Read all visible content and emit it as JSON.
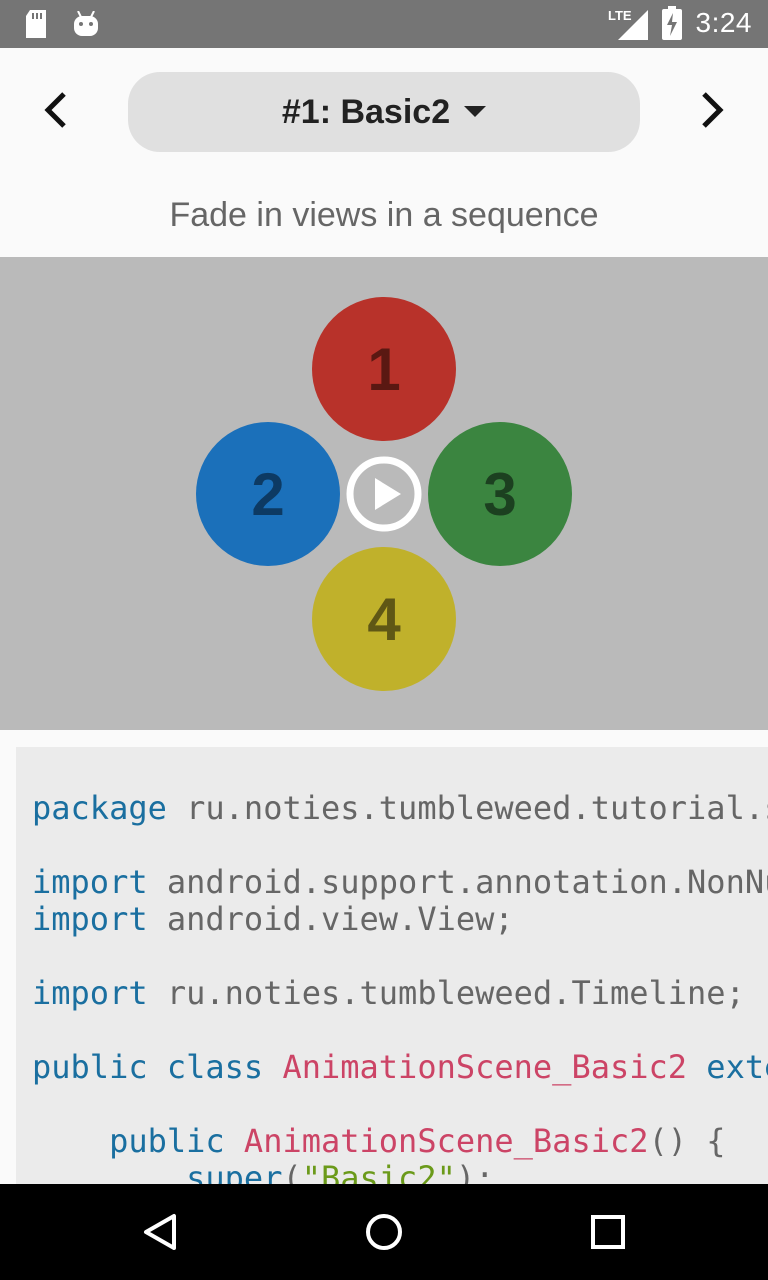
{
  "status_bar": {
    "time": "3:24",
    "network": "LTE",
    "icons": [
      "sd-card-icon",
      "android-icon",
      "lte-signal-icon",
      "battery-charging-icon"
    ]
  },
  "toolbar": {
    "title": "#1: Basic2",
    "prev_icon": "chevron-left-icon",
    "next_icon": "chevron-right-icon",
    "dropdown_icon": "caret-down-icon"
  },
  "subtitle": "Fade in views in a sequence",
  "scene": {
    "background": "#bababa",
    "circles": [
      {
        "label": "1",
        "color": "#b8322a",
        "text_color": "#5a1812"
      },
      {
        "label": "2",
        "color": "#1b70ba",
        "text_color": "#0d3a63"
      },
      {
        "label": "3",
        "color": "#3b8540",
        "text_color": "#1c4020"
      },
      {
        "label": "4",
        "color": "#c0b12b",
        "text_color": "#5f5715"
      }
    ],
    "play_icon": "play-circle-icon"
  },
  "code": {
    "lines": [
      [
        {
          "t": "package",
          "c": "kw"
        },
        {
          "t": " ru.noties.tumbleweed.tutorial.s",
          "c": ""
        }
      ],
      [
        {
          "t": "import",
          "c": "kw"
        },
        {
          "t": " android.support.annotation.NonNu",
          "c": ""
        }
      ],
      [
        {
          "t": "import",
          "c": "kw"
        },
        {
          "t": " android.view.View;",
          "c": ""
        }
      ],
      [
        {
          "t": "import",
          "c": "kw"
        },
        {
          "t": " ru.noties.tumbleweed.Timeline;",
          "c": ""
        }
      ],
      [
        {
          "t": "public class",
          "c": "kw"
        },
        {
          "t": " ",
          "c": ""
        },
        {
          "t": "AnimationScene_Basic2",
          "c": "cls"
        },
        {
          "t": " exte",
          "c": "kw"
        }
      ],
      [
        {
          "t": "    public",
          "c": "kw"
        },
        {
          "t": " ",
          "c": ""
        },
        {
          "t": "AnimationScene_Basic2",
          "c": "cls"
        },
        {
          "t": "() {",
          "c": ""
        }
      ],
      [
        {
          "t": "        super",
          "c": "kw"
        },
        {
          "t": "(",
          "c": ""
        },
        {
          "t": "\"Basic2\"",
          "c": "str"
        },
        {
          "t": ");",
          "c": ""
        }
      ]
    ]
  },
  "navbar": {
    "back_icon": "back-triangle-icon",
    "home_icon": "home-circle-icon",
    "recent_icon": "recent-square-icon"
  }
}
